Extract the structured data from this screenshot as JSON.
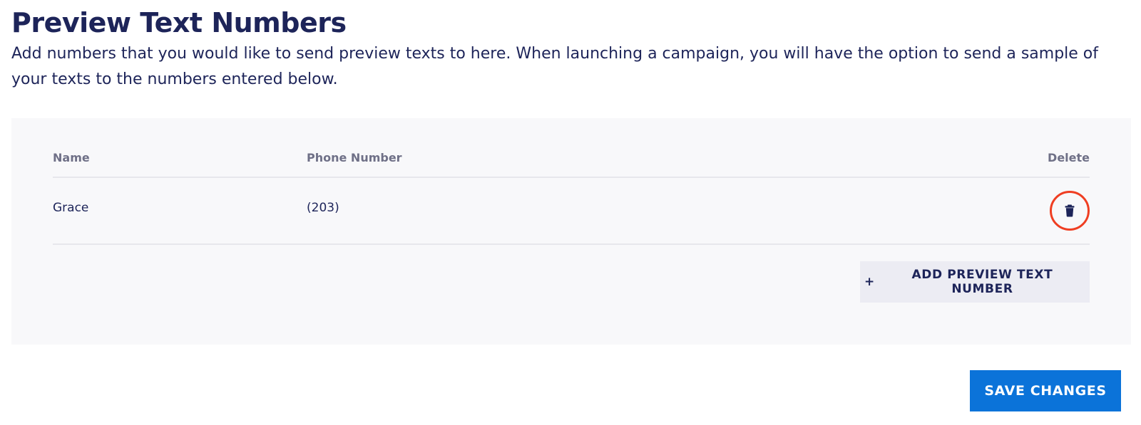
{
  "header": {
    "title": "Preview Text Numbers",
    "description": "Add numbers that you would like to send preview texts to here. When launching a campaign, you will have the option to send a sample of your texts to the numbers entered below."
  },
  "table": {
    "columns": {
      "name": "Name",
      "phone": "Phone Number",
      "delete": "Delete"
    },
    "rows": [
      {
        "name": "Grace",
        "phone": "(203)",
        "delete_icon": "trash-icon"
      }
    ]
  },
  "actions": {
    "add_symbol": "+",
    "add_label": "ADD PREVIEW TEXT NUMBER",
    "save_label": "SAVE CHANGES"
  },
  "colors": {
    "title": "#1d2459",
    "save_button": "#0b73d9",
    "highlight_ring": "#ef3e22",
    "panel_bg": "#f8f8fa"
  }
}
